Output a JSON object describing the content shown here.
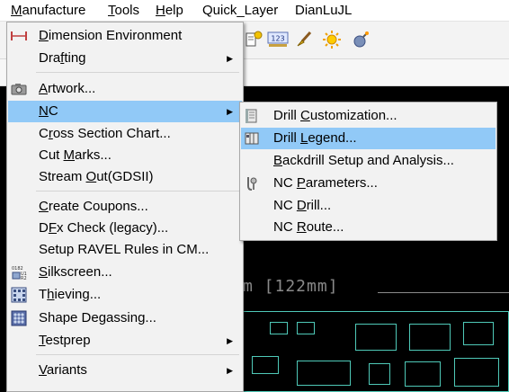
{
  "menubar": {
    "items": [
      {
        "label": "Manufacture",
        "accel": "M"
      },
      {
        "label": "Tools",
        "accel": "T"
      },
      {
        "label": "Help",
        "accel": "H"
      },
      {
        "label": "Quick_Layer",
        "accel": ""
      },
      {
        "label": "DianLuJL",
        "accel": ""
      }
    ]
  },
  "toolbar": {
    "icons": [
      "info-pin-icon",
      "number-123-icon",
      "brush-icon",
      "sun-icon",
      "bomb-icon"
    ]
  },
  "canvas": {
    "dimension_text": "m [122mm]",
    "background": "#000000",
    "trace_color": "#4fc9b8"
  },
  "menu": {
    "items": [
      {
        "label": "Dimension Environment",
        "accel": "D",
        "submenu": false,
        "icon": "dimension-icon"
      },
      {
        "label": "Drafting",
        "accel": "f",
        "submenu": true,
        "icon": ""
      },
      {
        "label": "Artwork...",
        "accel": "A",
        "submenu": false,
        "icon": "camera-icon"
      },
      {
        "label": "NC",
        "accel": "N",
        "submenu": true,
        "icon": "",
        "selected": true
      },
      {
        "label": "Cross Section Chart...",
        "accel": "r",
        "submenu": false,
        "icon": ""
      },
      {
        "label": "Cut Marks...",
        "accel": "M",
        "submenu": false,
        "icon": ""
      },
      {
        "label": "Stream Out(GDSII)",
        "accel": "O",
        "submenu": false,
        "icon": ""
      },
      {
        "label": "Create Coupons...",
        "accel": "C",
        "submenu": false,
        "icon": ""
      },
      {
        "label": "DFx Check (legacy)...",
        "accel": "F",
        "submenu": false,
        "icon": ""
      },
      {
        "label": "Setup RAVEL Rules in CM...",
        "accel": "",
        "submenu": false,
        "icon": ""
      },
      {
        "label": "Silkscreen...",
        "accel": "S",
        "submenu": false,
        "icon": "silkscreen-icon"
      },
      {
        "label": "Thieving...",
        "accel": "h",
        "submenu": false,
        "icon": "thieving-icon"
      },
      {
        "label": "Shape Degassing...",
        "accel": "",
        "submenu": false,
        "icon": "degassing-icon"
      },
      {
        "label": "Testprep",
        "accel": "T",
        "submenu": true,
        "icon": ""
      },
      {
        "label": "Variants",
        "accel": "V",
        "submenu": true,
        "icon": ""
      }
    ]
  },
  "submenu": {
    "items": [
      {
        "label": "Drill Customization...",
        "accel": "C",
        "icon": "drill-customization-icon"
      },
      {
        "label": "Drill Legend...",
        "accel": "L",
        "icon": "drill-legend-icon",
        "selected": true
      },
      {
        "label": "Backdrill Setup and Analysis...",
        "accel": "B",
        "icon": ""
      },
      {
        "label": "NC Parameters...",
        "accel": "P",
        "icon": "nc-parameters-icon"
      },
      {
        "label": "NC Drill...",
        "accel": "D",
        "icon": ""
      },
      {
        "label": "NC Route...",
        "accel": "R",
        "icon": ""
      }
    ]
  }
}
